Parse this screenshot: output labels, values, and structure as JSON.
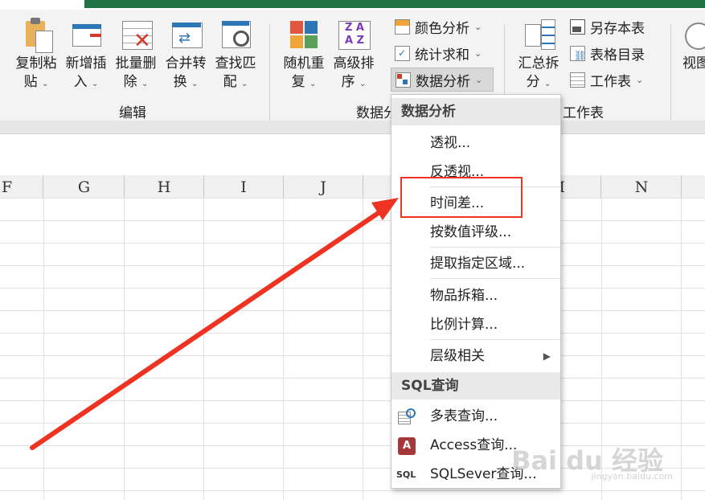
{
  "ribbon": {
    "edit_group": {
      "label": "编辑",
      "buttons": [
        {
          "l1": "复制粘",
          "l2": "贴"
        },
        {
          "l1": "新增插",
          "l2": "入"
        },
        {
          "l1": "批量删",
          "l2": "除"
        },
        {
          "l1": "合并转",
          "l2": "换"
        },
        {
          "l1": "查找匹",
          "l2": "配"
        }
      ]
    },
    "data_group": {
      "label": "数据分",
      "buttons": [
        {
          "l1": "随机重",
          "l2": "复"
        },
        {
          "l1": "高级排",
          "l2": "序"
        }
      ],
      "small": [
        "颜色分析",
        "统计求和",
        "数据分析"
      ]
    },
    "sheet_group": {
      "label": "工作表",
      "big": {
        "l1": "汇总拆",
        "l2": "分"
      },
      "small": [
        "另存本表",
        "表格目录",
        "工作表"
      ]
    },
    "view_label": "视图",
    "caret": "⌄",
    "colors": {
      "accent_green": "#1f7244",
      "highlight_red": "#ee3322"
    }
  },
  "columns": [
    "F",
    "G",
    "H",
    "I",
    "J",
    "M",
    "N"
  ],
  "menu": {
    "section1": "数据分析",
    "items1": [
      "透视...",
      "反透视...",
      "时间差...",
      "按数值评级...",
      "提取指定区域...",
      "物品拆箱...",
      "比例计算...",
      "层级相关"
    ],
    "submenu_arrow": "▶",
    "section2": "SQL查询",
    "items2": [
      "多表查询...",
      "Access查询...",
      "SQLSever查询..."
    ],
    "sql_icon_text": "SQL",
    "access_icon_text": "A"
  },
  "watermark": {
    "text": "Bai du 经验",
    "sub": "jingyan.baidu.com"
  }
}
